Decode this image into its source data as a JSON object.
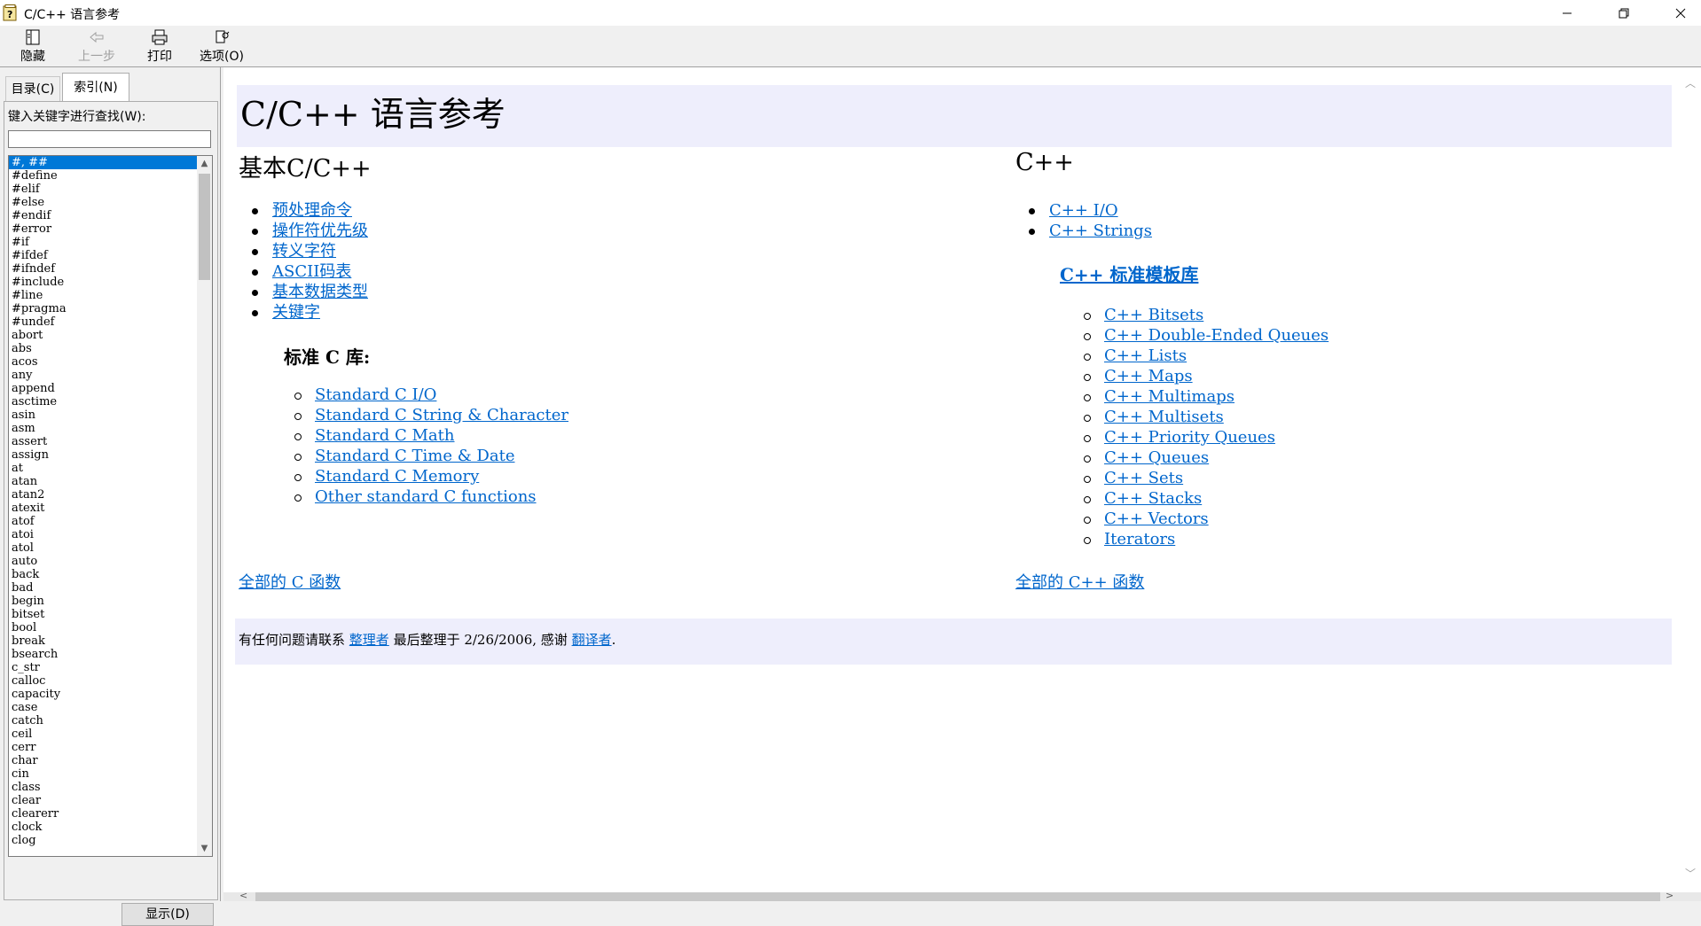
{
  "window": {
    "title": "C/C++ 语言参考"
  },
  "toolbar": {
    "hide": "隐藏",
    "back": "上一步",
    "print": "打印",
    "options": "选项(O)"
  },
  "leftpane": {
    "tab_contents": "目录(C)",
    "tab_index": "索引(N)",
    "keyword_label": "键入关键字进行查找(W):",
    "keyword_value": "",
    "show_button": "显示(D)",
    "keywords": [
      "#, ##",
      "#define",
      "#elif",
      "#else",
      "#endif",
      "#error",
      "#if",
      "#ifdef",
      "#ifndef",
      "#include",
      "#line",
      "#pragma",
      "#undef",
      "abort",
      "abs",
      "acos",
      "any",
      "append",
      "asctime",
      "asin",
      "asm",
      "assert",
      "assign",
      "at",
      "atan",
      "atan2",
      "atexit",
      "atof",
      "atoi",
      "atol",
      "auto",
      "back",
      "bad",
      "begin",
      "bitset",
      "bool",
      "break",
      "bsearch",
      "c_str",
      "calloc",
      "capacity",
      "case",
      "catch",
      "ceil",
      "cerr",
      "char",
      "cin",
      "class",
      "clear",
      "clearerr",
      "clock",
      "clog"
    ],
    "selected_index": 0
  },
  "content": {
    "title": "C/C++ 语言参考",
    "left_heading": "基本C/C++",
    "left_links": [
      "预处理命令",
      "操作符优先级",
      "转义字符",
      "ASCII码表",
      "基本数据类型",
      "关键字"
    ],
    "stdc_heading": "标准 C 库:",
    "stdc_links": [
      "Standard C I/O",
      "Standard C String & Character",
      "Standard C Math",
      "Standard C Time & Date",
      "Standard C Memory",
      "Other standard C functions"
    ],
    "all_c": "全部的 C 函数",
    "right_heading": "C++",
    "right_links": [
      "C++ I/O",
      "C++ Strings"
    ],
    "stl_heading": "C++ 标准模板库",
    "stl_links": [
      "C++ Bitsets",
      "C++ Double-Ended Queues",
      "C++ Lists",
      "C++ Maps",
      "C++ Multimaps",
      "C++ Multisets",
      "C++ Priority Queues",
      "C++ Queues",
      "C++ Sets",
      "C++ Stacks",
      "C++ Vectors",
      "Iterators"
    ],
    "all_cpp": "全部的 C++ 函数",
    "footer": {
      "prefix": "有任何问题请联系 ",
      "maintainer": "整理者",
      "middle": " 最后整理于 2/26/2006, 感谢 ",
      "translator": "翻译者",
      "suffix": "."
    }
  },
  "colors": {
    "band": "#eeeefc",
    "link": "#0066cc",
    "selection": "#0078d7"
  },
  "icons": {
    "app": "help-book-icon",
    "hide": "hide-pane-icon",
    "back": "back-arrow-icon",
    "print": "printer-icon",
    "options": "options-icon"
  }
}
